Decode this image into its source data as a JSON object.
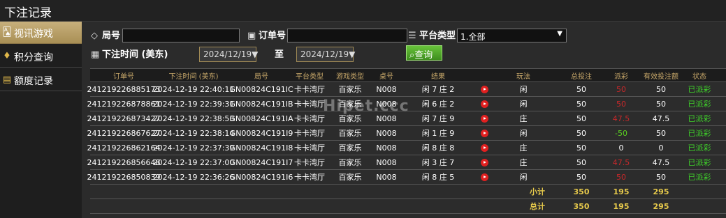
{
  "title": "下注记录",
  "sidebar": {
    "items": [
      {
        "label": "视讯游戏",
        "icon": "cards-icon",
        "active": true
      },
      {
        "label": "积分查询",
        "icon": "diamond-icon",
        "active": false
      },
      {
        "label": "额度记录",
        "icon": "document-icon",
        "active": false
      }
    ]
  },
  "filters": {
    "round_label": "局号",
    "round_value": "",
    "order_label": "订单号",
    "order_value": "",
    "platform_label": "平台类型",
    "platform_value": "1.全部",
    "time_label": "下注时间 (美东)",
    "date_from": "2024/12/19",
    "to_label": "至",
    "date_to": "2024/12/19",
    "query_label": "查询"
  },
  "table": {
    "headers": [
      "订单号",
      "下注时间 (美东)",
      "局号",
      "平台类型",
      "游戏类型",
      "桌号",
      "结果",
      "",
      "玩法",
      "总投注",
      "派彩",
      "有效投注额",
      "状态"
    ],
    "rows": [
      {
        "order": "241219226885173",
        "time": "2024-12-19 22:40:11",
        "round": "GN00824C191IC",
        "platform": "卡卡湾厅",
        "game": "百家乐",
        "table": "N008",
        "result": "闲 7 庄 2",
        "play": "闲",
        "bet": "50",
        "payout": "50",
        "payout_sign": "neg",
        "valid": "50",
        "status": "已派彩"
      },
      {
        "order": "241219226878861",
        "time": "2024-12-19 22:39:31",
        "round": "GN00824C191IB",
        "platform": "卡卡湾厅",
        "game": "百家乐",
        "table": "N008",
        "result": "闲 6 庄 2",
        "play": "闲",
        "bet": "50",
        "payout": "50",
        "payout_sign": "neg",
        "valid": "50",
        "status": "已派彩"
      },
      {
        "order": "241219226873427",
        "time": "2024-12-19 22:38:53",
        "round": "GN00824C191IA",
        "platform": "卡卡湾厅",
        "game": "百家乐",
        "table": "N008",
        "result": "闲 7 庄 9",
        "play": "庄",
        "bet": "50",
        "payout": "47.5",
        "payout_sign": "neg",
        "valid": "47.5",
        "status": "已派彩"
      },
      {
        "order": "241219226867627",
        "time": "2024-12-19 22:38:14",
        "round": "GN00824C191I9",
        "platform": "卡卡湾厅",
        "game": "百家乐",
        "table": "N008",
        "result": "闲 1 庄 9",
        "play": "闲",
        "bet": "50",
        "payout": "-50",
        "payout_sign": "pos",
        "valid": "50",
        "status": "已派彩"
      },
      {
        "order": "241219226862164",
        "time": "2024-12-19 22:37:39",
        "round": "GN00824C191I8",
        "platform": "卡卡湾厅",
        "game": "百家乐",
        "table": "N008",
        "result": "闲 8 庄 8",
        "play": "庄",
        "bet": "50",
        "payout": "0",
        "payout_sign": "zero",
        "valid": "0",
        "status": "已派彩"
      },
      {
        "order": "241219226856648",
        "time": "2024-12-19 22:37:00",
        "round": "GN00824C191I7",
        "platform": "卡卡湾厅",
        "game": "百家乐",
        "table": "N008",
        "result": "闲 3 庄 7",
        "play": "庄",
        "bet": "50",
        "payout": "47.5",
        "payout_sign": "neg",
        "valid": "47.5",
        "status": "已派彩"
      },
      {
        "order": "241219226850839",
        "time": "2024-12-19 22:36:26",
        "round": "GN00824C191I6",
        "platform": "卡卡湾厅",
        "game": "百家乐",
        "table": "N008",
        "result": "闲 8 庄 5",
        "play": "闲",
        "bet": "50",
        "payout": "50",
        "payout_sign": "neg",
        "valid": "50",
        "status": "已派彩"
      }
    ],
    "subtotal": {
      "label": "小计",
      "bet": "350",
      "payout": "195",
      "valid": "295"
    },
    "total": {
      "label": "总计",
      "bet": "350",
      "payout": "195",
      "valid": "295"
    }
  },
  "watermark": "Hipet.ccc",
  "colors": {
    "accent": "#c8a86a",
    "active_tab": "#b59a62",
    "negative": "#c8282a",
    "positive": "#5bd320",
    "status": "#3fd12a",
    "total": "#e6c94b"
  }
}
